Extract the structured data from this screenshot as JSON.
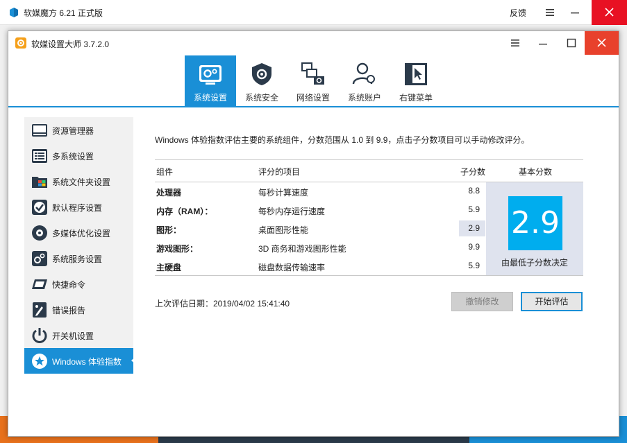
{
  "outer": {
    "title": "软媒魔方 6.21 正式版",
    "feedback": "反馈"
  },
  "dialog": {
    "title": "软媒设置大师 3.7.2.0"
  },
  "nav": {
    "tabs": [
      {
        "label": "系统设置",
        "icon": "system-settings-icon",
        "active": true
      },
      {
        "label": "系统安全",
        "icon": "shield-icon",
        "active": false
      },
      {
        "label": "网络设置",
        "icon": "network-icon",
        "active": false
      },
      {
        "label": "系统账户",
        "icon": "users-icon",
        "active": false
      },
      {
        "label": "右键菜单",
        "icon": "context-menu-icon",
        "active": false
      }
    ]
  },
  "sidebar": {
    "items": [
      {
        "label": "资源管理器",
        "icon": "explorer-icon"
      },
      {
        "label": "多系统设置",
        "icon": "multi-boot-icon"
      },
      {
        "label": "系统文件夹设置",
        "icon": "folder-icon"
      },
      {
        "label": "默认程序设置",
        "icon": "check-icon"
      },
      {
        "label": "多媒体优化设置",
        "icon": "media-icon"
      },
      {
        "label": "系统服务设置",
        "icon": "services-icon"
      },
      {
        "label": "快捷命令",
        "icon": "command-icon"
      },
      {
        "label": "错误报告",
        "icon": "report-icon"
      },
      {
        "label": "开关机设置",
        "icon": "power-icon"
      },
      {
        "label": "Windows 体验指数",
        "icon": "star-icon"
      }
    ]
  },
  "main": {
    "description": "Windows 体验指数评估主要的系统组件，分数范围从 1.0 到 9.9，点击子分数项目可以手动修改评分。",
    "headers": {
      "component": "组件",
      "rated": "评分的项目",
      "subscore": "子分数",
      "basescore": "基本分数"
    },
    "rows": [
      {
        "component": "处理器",
        "rated": "每秒计算速度",
        "subscore": "8.8"
      },
      {
        "component": "内存（RAM）：",
        "rated": "每秒内存运行速度",
        "subscore": "5.9"
      },
      {
        "component": "图形：",
        "rated": "桌面图形性能",
        "subscore": "2.9"
      },
      {
        "component": "游戏图形：",
        "rated": "3D 商务和游戏图形性能",
        "subscore": "9.9"
      },
      {
        "component": "主硬盘",
        "rated": "磁盘数据传输速率",
        "subscore": "5.9"
      }
    ],
    "base_score": "2.9",
    "base_caption": "由最低子分数决定",
    "last_date": "上次评估日期：2019/04/02 15:41:40",
    "undo_label": "撤销修改",
    "start_label": "开始评估"
  },
  "colors": {
    "accent": "#1a8fd6",
    "score_box": "#00adee",
    "close_red": "#e81123"
  }
}
